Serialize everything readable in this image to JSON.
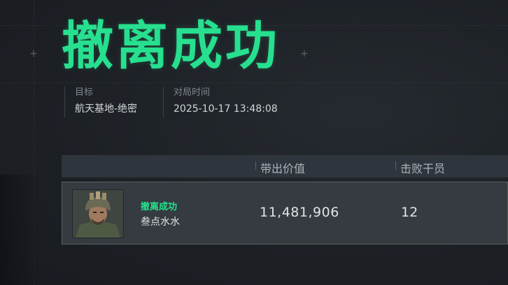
{
  "title": "撤离成功",
  "meta": {
    "target_label": "目标",
    "target_value": "航天基地-绝密",
    "time_label": "对局时间",
    "time_value": "2025-10-17 13:48:08"
  },
  "table": {
    "headers": [
      "带出价值",
      "击败干员"
    ],
    "rows": [
      {
        "status": "撤离成功",
        "player_name": "叁点水水",
        "value": "11,481,906",
        "kills": "12"
      }
    ]
  },
  "colors": {
    "accent": "#27e08f",
    "background": "#1d2126",
    "header_bar": "#2e353c",
    "row_bg": "#353b40"
  },
  "icons": {
    "avatar": "operator-portrait"
  }
}
